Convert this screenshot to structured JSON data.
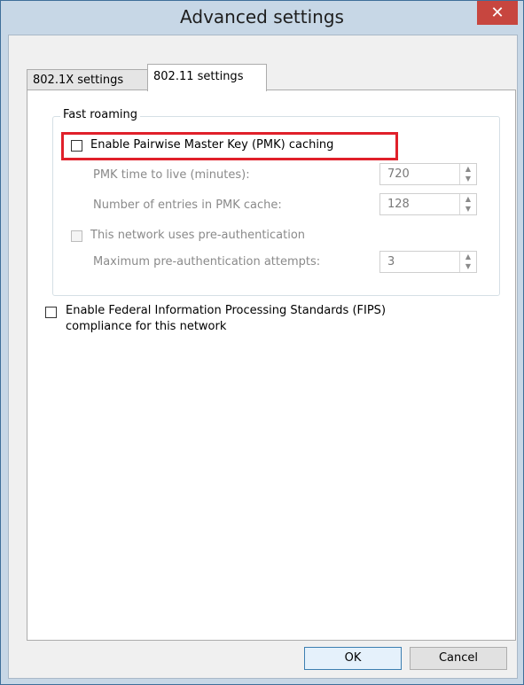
{
  "window": {
    "title": "Advanced settings",
    "close_glyph": "✕"
  },
  "tabs": [
    {
      "label": "802.1X settings",
      "active": false
    },
    {
      "label": "802.11 settings",
      "active": true
    }
  ],
  "fast_roaming": {
    "legend": "Fast roaming",
    "pmk_caching_label": "Enable Pairwise Master Key (PMK) caching",
    "pmk_ttl_label": "PMK time to live (minutes):",
    "pmk_ttl_value": "720",
    "pmk_entries_label": "Number of entries in PMK cache:",
    "pmk_entries_value": "128",
    "preauth_label": "This network uses pre-authentication",
    "preauth_attempts_label": "Maximum pre-authentication attempts:",
    "preauth_attempts_value": "3"
  },
  "fips": {
    "line1": "Enable Federal Information Processing Standards (FIPS)",
    "line2": "compliance for this network"
  },
  "buttons": {
    "ok": "OK",
    "cancel": "Cancel"
  },
  "colors": {
    "highlight": "#e0202a",
    "close_button": "#c7463f",
    "window_frame": "#c7d7e6"
  }
}
